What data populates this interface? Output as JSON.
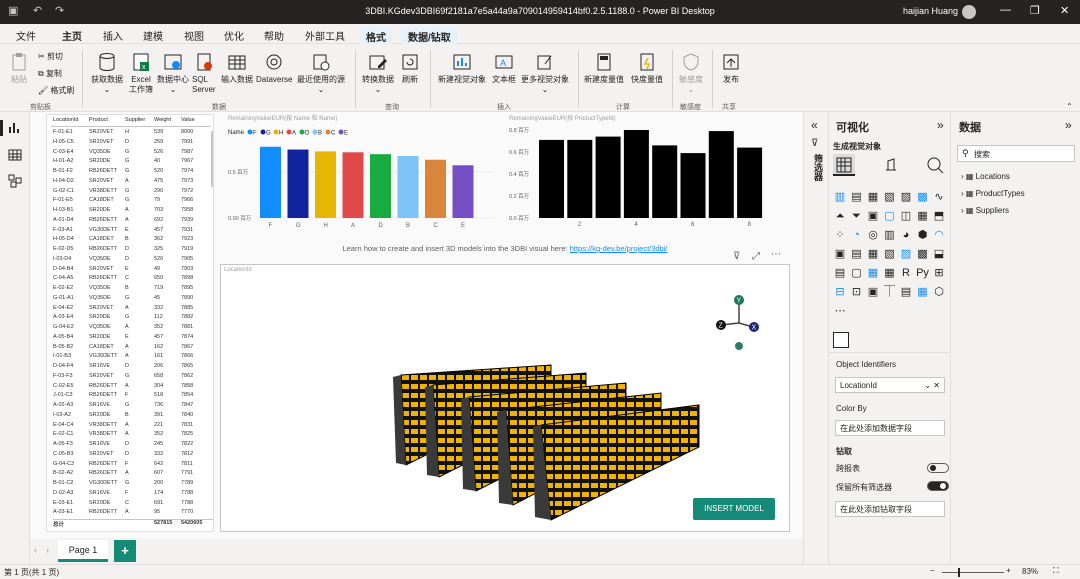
{
  "window": {
    "title": "3DBI.KGdev3DBI69f2181a7e5a44a9a709014959414bf0.2.5.1188.0 - Power BI Desktop",
    "user": "haijian Huang"
  },
  "menu": {
    "tabs": [
      "文件",
      "主页",
      "插入",
      "建模",
      "视图",
      "优化",
      "帮助",
      "外部工具"
    ],
    "context_tabs": [
      "格式",
      "数据/钻取"
    ],
    "active": "主页"
  },
  "ribbon": {
    "clipboard": {
      "paste": "粘贴",
      "cut": "剪切",
      "copy": "复制",
      "format_painter": "格式刷",
      "group": "剪贴板"
    },
    "data": {
      "get_data": "获取数据",
      "excel": "Excel 工作簿",
      "data_hub": "数据中心",
      "sql": "SQL Server",
      "enter": "输入数据",
      "dataverse": "Dataverse",
      "recent": "最近使用的源",
      "group": "数据"
    },
    "query": {
      "transform": "转换数据",
      "refresh": "刷新",
      "group": "查询"
    },
    "insert": {
      "new_visual": "新建视觉对象",
      "textbox": "文本框",
      "more": "更多视觉对象",
      "group": "插入"
    },
    "calc": {
      "new_measure": "新建度量值",
      "quick_measure": "快度量值",
      "group": "计算"
    },
    "sensitivity": {
      "label": "敏感度",
      "group": "敏感度"
    },
    "share": {
      "publish": "发布",
      "group": "共享"
    }
  },
  "table": {
    "headers": [
      "LocationId",
      "Product",
      "Supplier",
      "Weight",
      "Value"
    ],
    "rows": [
      [
        "F-01-E1",
        "SR20VET",
        "H",
        "539",
        "8000"
      ],
      [
        "H-05-C5",
        "SR20VET",
        "D",
        "259",
        "7991"
      ],
      [
        "C-03-E4",
        "VQ35DE",
        "G",
        "526",
        "7987"
      ],
      [
        "H-01-A2",
        "SR20DE",
        "G",
        "40",
        "7967"
      ],
      [
        "B-01-F2",
        "RB26DETT",
        "G",
        "520",
        "7974"
      ],
      [
        "H-04-D2",
        "SR20VET",
        "A",
        "475",
        "7973"
      ],
      [
        "G-02-C1",
        "VR38DETT",
        "G",
        "290",
        "7972"
      ],
      [
        "F-01-E5",
        "CA18DET",
        "G",
        "79",
        "7966"
      ],
      [
        "H-03-B1",
        "SR20DE",
        "A",
        "703",
        "7958"
      ],
      [
        "A-01-D4",
        "RB26DETT",
        "A",
        "692",
        "7939"
      ],
      [
        "F-03-A1",
        "VG30DETT",
        "E",
        "457",
        "7931"
      ],
      [
        "H-05-D4",
        "CA18DET",
        "B",
        "362",
        "7923"
      ],
      [
        "E-02-D5",
        "RB26DETT",
        "D",
        "325",
        "7919"
      ],
      [
        "I-03-D4",
        "VQ35DE",
        "D",
        "526",
        "7905"
      ],
      [
        "D-04-B4",
        "SR20VET",
        "E",
        "49",
        "7903"
      ],
      [
        "C-04-A5",
        "RB26DETT",
        "C",
        "650",
        "7898"
      ],
      [
        "E-02-E2",
        "VQ35DE",
        "B",
        "719",
        "7895"
      ],
      [
        "G-01-A1",
        "VQ35DE",
        "G",
        "45",
        "7890"
      ],
      [
        "E-04-E2",
        "SR20VET",
        "A",
        "332",
        "7885"
      ],
      [
        "A-03-E4",
        "SR20DE",
        "G",
        "112",
        "7882"
      ],
      [
        "G-04-E2",
        "VQ35DE",
        "A",
        "352",
        "7881"
      ],
      [
        "A-05-B4",
        "SR20DE",
        "E",
        "457",
        "7874"
      ],
      [
        "B-05-B2",
        "CA18DET",
        "A",
        "162",
        "7867"
      ],
      [
        "I-01-B3",
        "VG30DETT",
        "A",
        "161",
        "7866"
      ],
      [
        "D-04-F4",
        "SR16VE",
        "D",
        "206",
        "7865"
      ],
      [
        "F-03-F3",
        "SR20VET",
        "G",
        "658",
        "7862"
      ],
      [
        "C-02-E5",
        "RB26DETT",
        "A",
        "304",
        "7858"
      ],
      [
        "J-01-C3",
        "RB26DETT",
        "F",
        "518",
        "7854"
      ],
      [
        "A-02-A3",
        "SR16VE",
        "G",
        "736",
        "7847"
      ],
      [
        "I-03-A2",
        "SR20DE",
        "B",
        "391",
        "7840"
      ],
      [
        "E-04-C4",
        "VR38DETT",
        "A",
        "221",
        "7831"
      ],
      [
        "E-02-C1",
        "VR38DETT",
        "A",
        "352",
        "7825"
      ],
      [
        "A-05-F3",
        "SR16VE",
        "D",
        "245",
        "7822"
      ],
      [
        "C-05-B3",
        "SR20VET",
        "D",
        "332",
        "7812"
      ],
      [
        "G-04-C3",
        "RB26DETT",
        "F",
        "642",
        "7811"
      ],
      [
        "B-02-A2",
        "RB26DETT",
        "A",
        "607",
        "7791"
      ],
      [
        "B-01-C2",
        "VG30DETT",
        "G",
        "200",
        "7789"
      ],
      [
        "D-02-A3",
        "SR16VE",
        "F",
        "174",
        "7788"
      ],
      [
        "E-03-E1",
        "SR20DE",
        "C",
        "691",
        "7788"
      ],
      [
        "A-03-E1",
        "RB26DETT",
        "A",
        "95",
        "7770"
      ]
    ],
    "total_label": "总计",
    "total_weight": "527815",
    "total_value": "5420605"
  },
  "chart_data": [
    {
      "type": "bar",
      "title": "RemainingValueEUR(按 Name 和 Name)",
      "legend_title": "Name",
      "categories": [
        "F",
        "G",
        "H",
        "A",
        "D",
        "B",
        "C",
        "E"
      ],
      "values": [
        0.77,
        0.74,
        0.72,
        0.71,
        0.69,
        0.67,
        0.63,
        0.57
      ],
      "y_ticks": [
        "0.00 百万",
        "0.5 百万"
      ],
      "ylim": [
        0,
        0.8
      ],
      "colors": [
        "#118dff",
        "#12239e",
        "#e6b703",
        "#e14949",
        "#1aab40",
        "#7dc3f5",
        "#d9863c",
        "#744ec2"
      ]
    },
    {
      "type": "bar",
      "title": "RemainingValueEUR(按 ProductTypeId)",
      "x_ticks": [
        "2",
        "4",
        "6",
        "8"
      ],
      "values": [
        0.71,
        0.71,
        0.74,
        0.8,
        0.66,
        0.59,
        0.79,
        0.64
      ],
      "y_ticks": [
        "0.0 百万",
        "0.2 百万",
        "0.4 百万",
        "0.6 百万",
        "0.8 百万"
      ],
      "ylim": [
        0,
        0.8
      ]
    }
  ],
  "info": {
    "text": "Learn how to create and insert 3D models into the 3DBI visual here: ",
    "link": "https://kg-dev.be/project/3dbi/"
  },
  "scene": {
    "field_label": "LocationId",
    "insert_button": "INSERT MODEL",
    "axes": [
      "Y",
      "Z",
      "X"
    ]
  },
  "pages": {
    "tab": "Page 1",
    "add": "+"
  },
  "status": {
    "left": "第 1 页(共 1 页)",
    "zoom": "83%"
  },
  "filters_label": "筛选器",
  "viz": {
    "title": "可视化",
    "subtitle": "生成视觉对象",
    "object_identifiers": "Object Identifiers",
    "object_value": "LocationId",
    "color_by": "Color By",
    "placeholder": "在此处添加数据字段",
    "drill": "钻取",
    "cross_report": "跨报表",
    "keep_filters": "保留所有筛选器",
    "drill_placeholder": "在此处添加钻取字段"
  },
  "datapane": {
    "title": "数据",
    "search": "搜索",
    "fields": [
      "Locations",
      "ProductTypes",
      "Suppliers"
    ]
  }
}
